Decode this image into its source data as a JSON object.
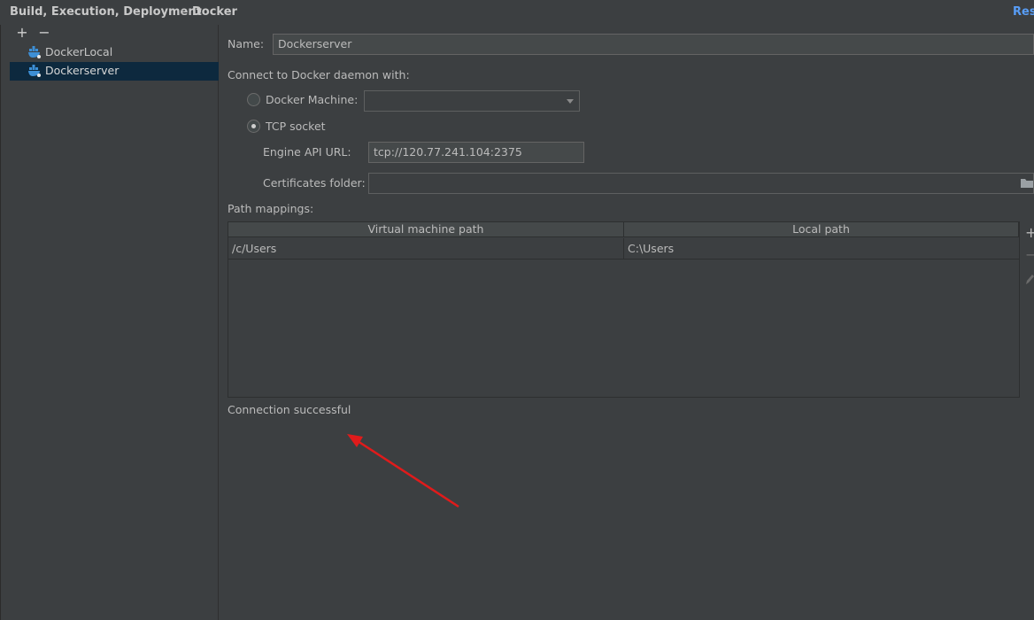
{
  "breadcrumb": {
    "parent": "Build, Execution, Deployment",
    "separator": "›",
    "current": "Docker",
    "reset_label": "Rese"
  },
  "toolbar": {
    "add": "+",
    "remove": "−"
  },
  "tree": {
    "items": [
      {
        "label": "DockerLocal",
        "selected": false,
        "icon": "docker-icon"
      },
      {
        "label": "Dockerserver",
        "selected": true,
        "icon": "docker-icon"
      }
    ]
  },
  "form": {
    "name_label": "Name:",
    "name_value": "Dockerserver",
    "connect_label": "Connect to Docker daemon with:",
    "docker_machine_label": "Docker Machine:",
    "docker_machine_value": "",
    "tcp_socket_label": "TCP socket",
    "tcp_socket_selected": true,
    "engine_api_label": "Engine API URL:",
    "engine_api_value": "tcp://120.77.241.104:2375",
    "certs_label": "Certificates folder:",
    "certs_value": "",
    "path_mappings_label": "Path mappings:"
  },
  "table": {
    "columns": [
      "Virtual machine path",
      "Local path"
    ],
    "rows": [
      [
        "/c/Users",
        "C:\\Users"
      ]
    ],
    "side_tools": {
      "add": "+",
      "remove": "−"
    }
  },
  "status": {
    "text": "Connection successful"
  },
  "colors": {
    "background": "#3c3f41",
    "selection": "#0d293e",
    "link": "#589df6",
    "annotation_arrow": "#e01b1b"
  }
}
